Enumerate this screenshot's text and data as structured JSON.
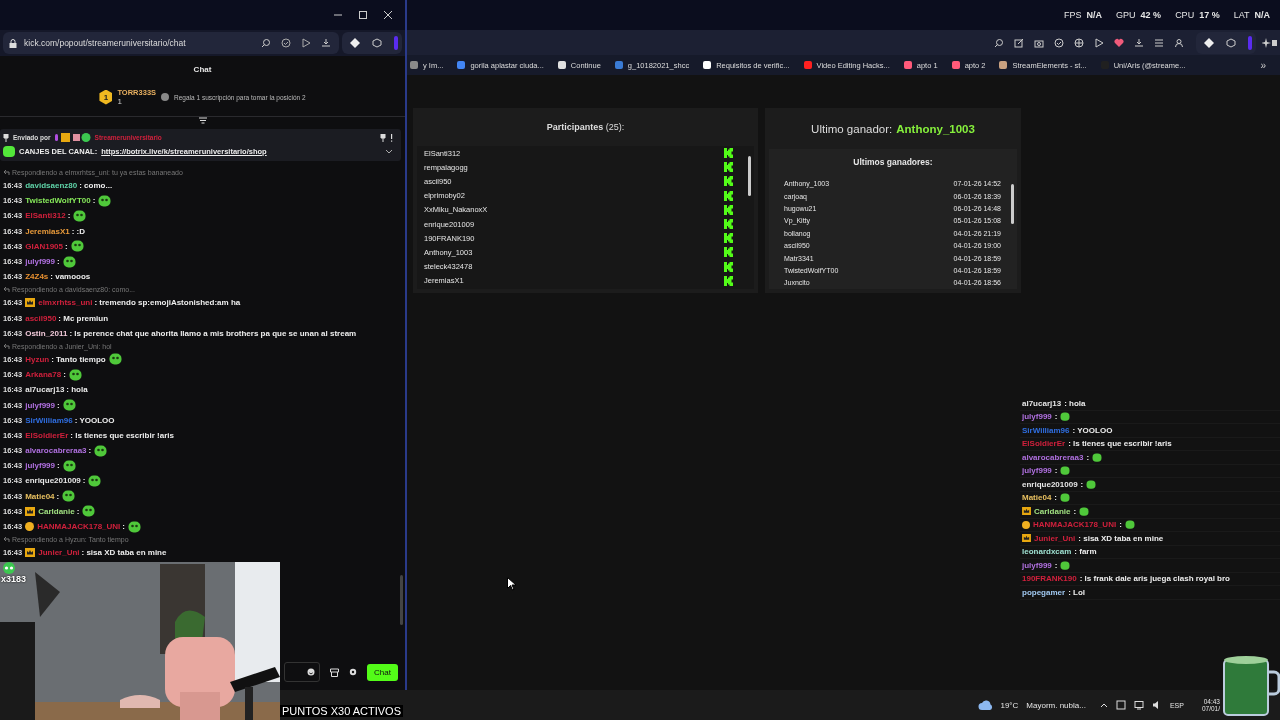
{
  "popup": {
    "url": "kick.com/popout/streameruniversitario/chat",
    "title": "Chat",
    "leader": {
      "rank": "1",
      "name": "TORR333S",
      "count": "1",
      "hint": "Regala 1 suscripción para tomar la posición 2"
    },
    "pinned": {
      "label": "Enviado por",
      "author": "Streameruniversitario",
      "title": "CANJES DEL CANAL:",
      "link": "https://botrix.live/k/streameruniversitario/shop"
    },
    "messages": [
      {
        "reply": "Respondiendo a elmxrhtss_uni: tu ya estas bananeado",
        "time": "16:43",
        "user": "davidsaenz80",
        "color": "#5fd3a8",
        "text": ": como...",
        "emote": false
      },
      {
        "time": "16:43",
        "user": "TwistedWolfYT00",
        "color": "#86e85a",
        "text": ":",
        "emote": true
      },
      {
        "time": "16:43",
        "user": "ElSanti312",
        "color": "#d0203c",
        "text": ":",
        "emote": true
      },
      {
        "time": "16:43",
        "user": "JeremiasX1",
        "color": "#e89a3a",
        "text": ": :D",
        "emote": false
      },
      {
        "time": "16:43",
        "user": "GIAN1905",
        "color": "#d0203c",
        "text": ":",
        "emote": true
      },
      {
        "time": "16:43",
        "user": "julyf999",
        "color": "#b070e0",
        "text": ":",
        "emote": true
      },
      {
        "time": "16:43",
        "user": "Z4Z4s",
        "color": "#e89030",
        "text": ": vamooos",
        "emote": false
      },
      {
        "reply": "Respondiendo a davidsaenz80: como...",
        "kind": "crown",
        "time": "16:43",
        "user": "elmxrhtss_uni",
        "color": "#d0203c",
        "text": ": tremendo sp:emojiAstonished:am ha",
        "emote": false
      },
      {
        "time": "16:43",
        "user": "ascil950",
        "color": "#d0203c",
        "text": ": Mc premiun",
        "emote": false
      },
      {
        "time": "16:43",
        "user": "Ostin_2011",
        "color": "#f0c8d8",
        "text": ": ls perence chat que ahorita llamo a mis brothers pa que se unan al stream",
        "emote": false
      },
      {
        "reply": "Respondiendo a Junier_Uni: hol",
        "time": "16:43",
        "user": "Hyzun",
        "color": "#d0203c",
        "text": ": Tanto tiempo",
        "emote": true
      },
      {
        "time": "16:43",
        "user": "Arkana78",
        "color": "#d0203c",
        "text": ":",
        "emote": true
      },
      {
        "time": "16:43",
        "user": "al7ucarj13",
        "color": "#e6e6e6",
        "text": ": hola",
        "emote": false
      },
      {
        "time": "16:43",
        "user": "julyf999",
        "color": "#b070e0",
        "text": ":",
        "emote": true
      },
      {
        "time": "16:43",
        "user": "SirWilliam96",
        "color": "#2f6ee0",
        "text": ": YOOLOO",
        "emote": false
      },
      {
        "time": "16:43",
        "user": "ElSoldierEr",
        "color": "#d0203c",
        "text": ": ls tienes que escribir !aris",
        "emote": false
      },
      {
        "time": "16:43",
        "user": "alvarocabreraa3",
        "color": "#b070e0",
        "text": ":",
        "emote": true
      },
      {
        "time": "16:43",
        "user": "julyf999",
        "color": "#b070e0",
        "text": ":",
        "emote": true
      },
      {
        "time": "16:43",
        "user": "enrique201009",
        "color": "#e6e6e6",
        "text": ":",
        "emote": true
      },
      {
        "time": "16:43",
        "user": "Matie04",
        "color": "#e8c060",
        "text": ":",
        "emote": true
      },
      {
        "kind": "crown",
        "time": "16:43",
        "user": "Carldanie",
        "color": "#a0e080",
        "text": ":",
        "emote": true
      },
      {
        "kind": "coin",
        "time": "16:43",
        "user": "HANMAJACK178_UNI",
        "color": "#d0203c",
        "text": ":",
        "emote": true
      },
      {
        "reply": "Respondiendo a Hyzun: Tanto tiempo",
        "kind": "crown",
        "time": "16:43",
        "user": "Junier_Uni",
        "color": "#d0203c",
        "text": ": sisa XD taba en mine",
        "emote": false
      }
    ],
    "send_button": "Chat"
  },
  "stats": [
    {
      "label": "FPS",
      "value": "N/A"
    },
    {
      "label": "GPU",
      "value": "42 %"
    },
    {
      "label": "CPU",
      "value": "17 %"
    },
    {
      "label": "LAT",
      "value": "N/A"
    }
  ],
  "bookmarks": [
    {
      "label": "y Im...",
      "color": "#8a8a8a"
    },
    {
      "label": "gorila aplastar ciuda...",
      "color": "#4285f4"
    },
    {
      "label": "Continue",
      "color": "#e0e0e0"
    },
    {
      "label": "g_10182021_shcc",
      "color": "#3a7bd5"
    },
    {
      "label": "Requisitos de verific...",
      "color": "#ffffff"
    },
    {
      "label": "Video Editing Hacks...",
      "color": "#ff2020"
    },
    {
      "label": "apto 1",
      "color": "#ff5a7a"
    },
    {
      "label": "apto 2",
      "color": "#ff5a7a"
    },
    {
      "label": "StreamElements - st...",
      "color": "#c8a080"
    },
    {
      "label": "Uni/Aris (@streame...",
      "color": "#202020"
    }
  ],
  "bookmarks_more": "»",
  "giveaway": {
    "participants_title": "**Participantes** (25):",
    "participants": [
      "ElSanti312",
      "rempalagogg",
      "ascil950",
      "elprimoby02",
      "XxMiku_NakanoxX",
      "enrique201009",
      "190FRANK190",
      "Anthony_1003",
      "steleck432478",
      "JeremiasX1"
    ],
    "last_winner_label": "Ultimo ganador:",
    "last_winner": "Anthony_1003",
    "winners_title": "Ultimos ganadores:",
    "winners": [
      {
        "name": "Anthony_1003",
        "date": "07-01-26 14:52"
      },
      {
        "name": "carjoaq",
        "date": "06-01-26 18:39"
      },
      {
        "name": "hugowu21",
        "date": "06-01-26 14:48"
      },
      {
        "name": "Vp_Kitty",
        "date": "05-01-26 15:08"
      },
      {
        "name": "bollanog",
        "date": "04-01-26 21:19"
      },
      {
        "name": "ascil950",
        "date": "04-01-26 19:00"
      },
      {
        "name": "Matr3341",
        "date": "04-01-26 18:59"
      },
      {
        "name": "TwistedWolfYT00",
        "date": "04-01-26 18:59"
      },
      {
        "name": "Juxncito",
        "date": "04-01-26 18:56"
      }
    ]
  },
  "overlay_chat": [
    {
      "user": "al7ucarj13",
      "color": "#e6e6e6",
      "text": ": hola",
      "emote": false
    },
    {
      "user": "julyf999",
      "color": "#b070e0",
      "text": ":",
      "emote": true
    },
    {
      "user": "SirWilliam96",
      "color": "#2f6ee0",
      "text": ": YOOLOO",
      "emote": false
    },
    {
      "user": "ElSoldierEr",
      "color": "#d0203c",
      "text": ": ls tienes que escribir !aris",
      "emote": false
    },
    {
      "user": "alvarocabreraa3",
      "color": "#b070e0",
      "text": ":",
      "emote": true
    },
    {
      "user": "julyf999",
      "color": "#b070e0",
      "text": ":",
      "emote": true
    },
    {
      "user": "enrique201009",
      "color": "#e6e6e6",
      "text": ":",
      "emote": true
    },
    {
      "user": "Matie04",
      "color": "#e8c060",
      "text": ":",
      "emote": true
    },
    {
      "kind": "crown",
      "user": "Carldanie",
      "color": "#a0e080",
      "text": ":",
      "emote": true
    },
    {
      "kind": "coin",
      "user": "HANMAJACK178_UNI",
      "color": "#d0203c",
      "text": ":",
      "emote": true
    },
    {
      "kind": "crown",
      "user": "Junier_Uni",
      "color": "#d0203c",
      "text": ": sisa XD taba en mine",
      "emote": false
    },
    {
      "user": "leonardxcam",
      "color": "#9ee0d0",
      "text": ": farm",
      "emote": false
    },
    {
      "user": "julyf999",
      "color": "#b070e0",
      "text": ":",
      "emote": true
    },
    {
      "user": "190FRANK190",
      "color": "#d0203c",
      "text": ": ls frank dale aris juega clash royal bro",
      "emote": false
    },
    {
      "user": "popegamer",
      "color": "#a0c8f0",
      "text": ": Lol",
      "emote": false
    }
  ],
  "stream_overlay": {
    "points": "x3183",
    "banner": "PUNTOS X30 ACTIVOS"
  },
  "taskbar": {
    "temp": "19°C",
    "weather": "Mayorm. nubla...",
    "lang": "ESP",
    "time": "04:43",
    "date": "07/01/"
  }
}
